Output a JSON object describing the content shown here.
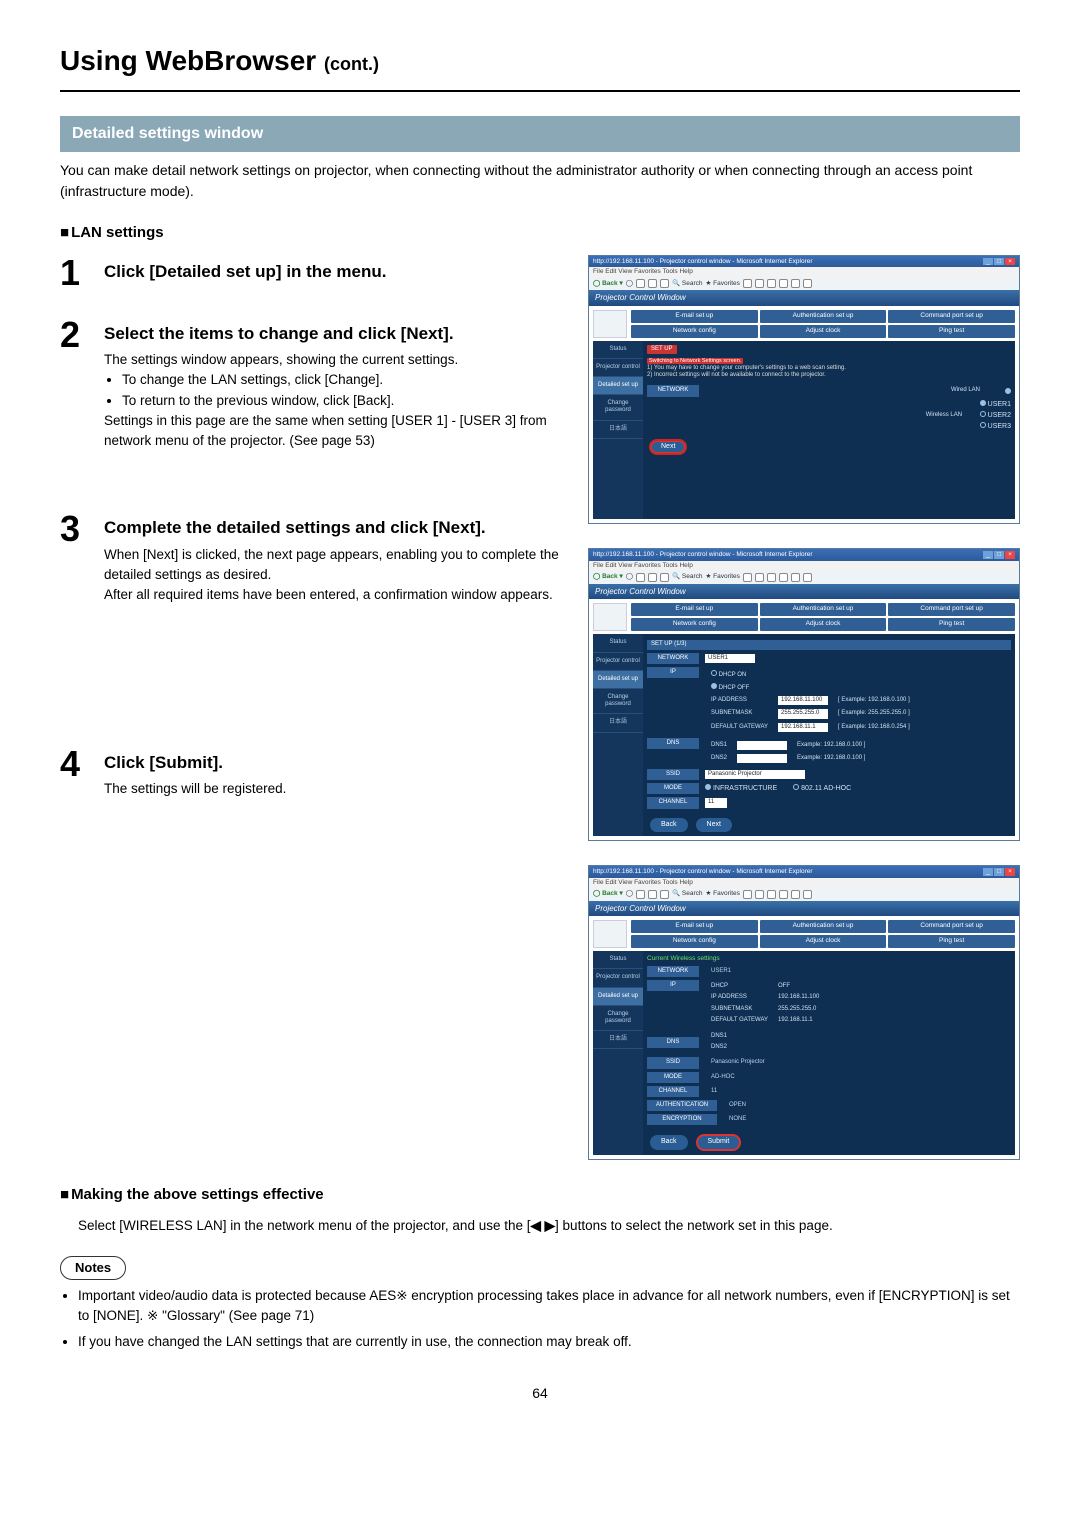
{
  "page": {
    "title_main": "Using WebBrowser",
    "title_cont": "(cont.)",
    "section_bar": "Detailed settings window",
    "intro": "You can make detail network settings on projector, when connecting without the administrator authority or when connecting through an access point (infrastructure mode).",
    "lan_heading": "LAN settings"
  },
  "steps": [
    {
      "num": "1",
      "head": "Click [Detailed set up] in the menu.",
      "text": ""
    },
    {
      "num": "2",
      "head": "Select the items to change and click [Next].",
      "text": "The settings window appears, showing the current settings.",
      "bullets": [
        "To change the LAN settings, click [Change].",
        "To return to the previous window, click [Back]."
      ],
      "tail": "Settings in this page are the same when setting [USER 1] - [USER 3] from network menu of the projector. (See page 53)"
    },
    {
      "num": "3",
      "head": "Complete the detailed settings and click [Next].",
      "text": "When [Next] is clicked, the next page appears, enabling you to complete the detailed settings as desired.\nAfter all required items have been entered, a confirmation window appears."
    },
    {
      "num": "4",
      "head": "Click [Submit].",
      "text": "The settings will be registered."
    }
  ],
  "making": {
    "heading": "Making the above settings effective",
    "text_a": "Select [WIRELESS LAN] in the network menu of the projector, and use the [",
    "text_b": "] buttons to select the network set in this page."
  },
  "notes": {
    "label": "Notes",
    "items": [
      "Important video/audio data is protected because AES※ encryption processing takes place in advance for all network numbers, even if [ENCRYPTION] is set to [NONE]. ※ \"Glossary\" (See page 71)",
      "If you have changed the LAN settings that are currently in use, the connection may break off."
    ]
  },
  "page_number": "64",
  "browser": {
    "titlebar": "http://192.168.11.100 - Projector control window - Microsoft Internet Explorer",
    "menubar": "File  Edit  View  Favorites  Tools  Help",
    "toolbar_back": "Back",
    "toolbar_search": "Search",
    "toolbar_fav": "Favorites",
    "pcw": "Projector Control Window",
    "tabs": [
      "E-mail set up",
      "Authentication set up",
      "Command port set up",
      "Network config",
      "Adjust clock",
      "Ping test"
    ],
    "side": {
      "status": "Status",
      "projector": "Projector control",
      "detailed": "Detailed set up",
      "change": "Change password",
      "jp": "日本語"
    }
  },
  "shot1": {
    "switch_prefix": "Switching to Network Settings screen.",
    "hint1": "1)  You may have to change your computer's settings to a web scan setting.",
    "hint2": "2)  Incorrect settings will not be available to connect to the projector.",
    "network_lbl": "NETWORK",
    "wired": "Wired LAN",
    "wireless": "Wireless LAN",
    "user1": "USER1",
    "user2": "USER2",
    "user3": "USER3",
    "next": "Next"
  },
  "shot2": {
    "set_hdr": "SET UP (1/3)",
    "network_lbl": "NETWORK",
    "network_val": "USER1",
    "ip_lbl": "IP",
    "dhcp_on": "DHCP ON",
    "dhcp_off": "DHCP OFF",
    "ip_addr_lbl": "IP ADDRESS",
    "ip_addr_val": "192.168.11.100",
    "ip_addr_ex": "[ Example: 192.168.0.100 ]",
    "subnet_lbl": "SUBNETMASK",
    "subnet_val": "255.255.255.0",
    "subnet_ex": "[ Example: 255.255.255.0 ]",
    "gw_lbl": "DEFAULT GATEWAY",
    "gw_val": "192.168.11.1",
    "gw_ex": "[ Example: 192.168.0.254 ]",
    "dns_lbl": "DNS",
    "dns1": "DNS1",
    "dns2": "DNS2",
    "dns_ex": "Example: 192.168.0.100 ]",
    "ssid_lbl": "SSID",
    "ssid_val": "Panasonic Projector",
    "mode_lbl": "MODE",
    "mode_infra": "INFRASTRUCTURE",
    "mode_adhoc": "802.11 AD-HOC",
    "chan_lbl": "CHANNEL",
    "chan_val": "11",
    "back": "Back",
    "next": "Next"
  },
  "shot3": {
    "hdr": "Current Wireless settings",
    "network_lbl": "NETWORK",
    "network_val": "USER1",
    "ip_lbl": "IP",
    "dhcp": "DHCP",
    "dhcp_val": "OFF",
    "ip_addr": "IP ADDRESS",
    "ip_addr_val": "192.168.11.100",
    "subnet": "SUBNETMASK",
    "subnet_val": "255.255.255.0",
    "gw": "DEFAULT GATEWAY",
    "gw_val": "192.168.11.1",
    "dns_lbl": "DNS",
    "dns1": "DNS1",
    "dns2": "DNS2",
    "ssid_lbl": "SSID",
    "ssid_val": "Panasonic Projector",
    "mode_lbl": "MODE",
    "mode_val": "AD-HOC",
    "chan_lbl": "CHANNEL",
    "chan_val": "11",
    "auth_lbl": "AUTHENTICATION",
    "auth_val": "OPEN",
    "enc_lbl": "ENCRYPTION",
    "enc_val": "NONE",
    "back": "Back",
    "submit": "Submit"
  }
}
